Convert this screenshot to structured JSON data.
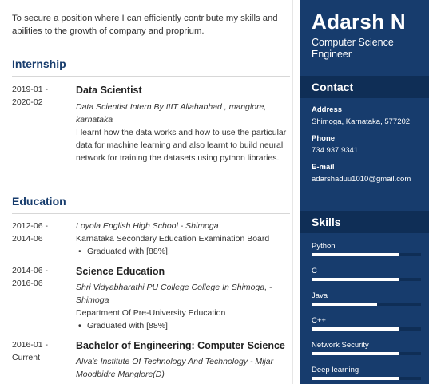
{
  "objective": "To secure a position where I can efficiently contribute my skills and abilities to the growth of company and proprium.",
  "internship": {
    "title": "Internship",
    "entries": [
      {
        "dates": "2019-01 -\n2020-02",
        "role": "Data Scientist",
        "org": "Data Scientist Intern By IIIT Allahabhad , manglore, karnataka",
        "description": "I learnt how the data works and how to use the particular data for machine learning and also learnt to build neural network for training the datasets using python libraries."
      }
    ]
  },
  "education": {
    "title": "Education",
    "entries": [
      {
        "dates": "2012-06 -\n2014-06",
        "school": "Loyola English High School - Shimoga",
        "board": "Karnataka Secondary Education Examination Board",
        "bullet": "Graduated with [88%]."
      },
      {
        "dates": "2014-06 -\n2016-06",
        "degree": "Science Education",
        "school": "Shri Vidyabharathi PU College College In Shimoga, - Shimoga",
        "board": "Department Of Pre-University Education",
        "bullet": "Graduated with [88%]"
      },
      {
        "dates": "2016-01 -\nCurrent",
        "degree": "Bachelor of Engineering: Computer Science",
        "school": "Alva's Institute Of Technology And Technology - Mijar Moodbidre Manglore(D)"
      }
    ]
  },
  "sidebar": {
    "name": "Adarsh N",
    "role": "Computer Science Engineer",
    "contact_title": "Contact",
    "address_label": "Address",
    "address": "Shimoga, Karnataka, 577202",
    "phone_label": "Phone",
    "phone": "734 937 9341",
    "email_label": "E-mail",
    "email": "adarshaduu1010@gmail.com",
    "skills_title": "Skills",
    "skills": [
      {
        "name": "Python",
        "level": 0.8
      },
      {
        "name": "C",
        "level": 0.8
      },
      {
        "name": "Java",
        "level": 0.6
      },
      {
        "name": "C++",
        "level": 0.8
      },
      {
        "name": "Network Security",
        "level": 0.8
      },
      {
        "name": "Deep learning",
        "level": 0.8
      }
    ]
  },
  "colors": {
    "sidebar_bg": "#173c6d",
    "band_bg": "#0f2e56",
    "heading": "#173c6d"
  }
}
